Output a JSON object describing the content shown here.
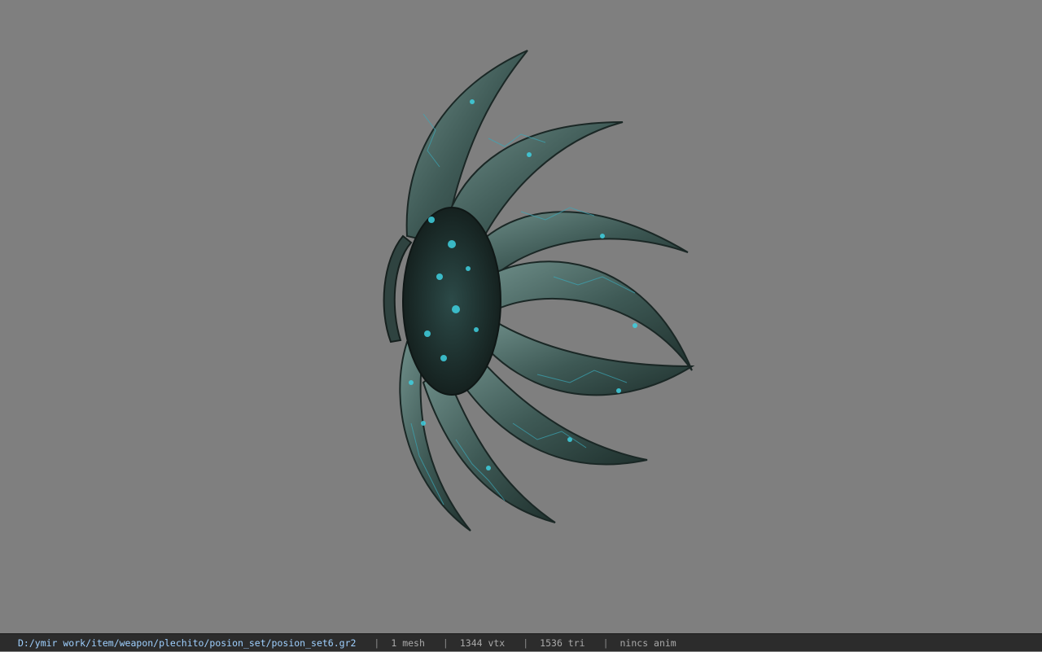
{
  "viewer": {
    "model_icon": "weapon-mesh-preview"
  },
  "status_bar": {
    "file_path": "D:/ymir work/item/weapon/plechito/posion_set/posion_set6.gr2",
    "separator": "|",
    "mesh_count": "1 mesh",
    "vertex_count": "1344 vtx",
    "triangle_count": "1536 tri",
    "animation": "nincs anim"
  },
  "colors": {
    "background": "#7f7f7f",
    "model_dark": "#223431",
    "model_light": "#5e7c78",
    "glow": "#3fd0e0",
    "status_bg": "#2c2c2c"
  }
}
